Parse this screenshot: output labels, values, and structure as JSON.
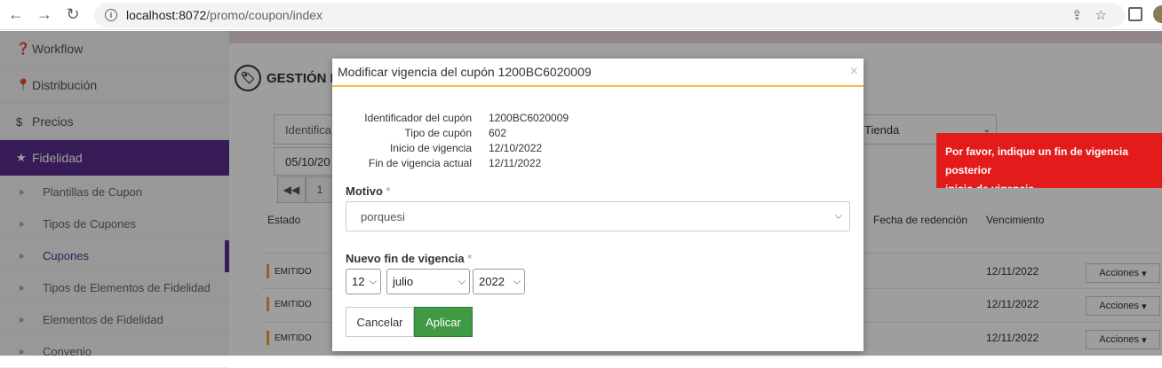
{
  "browser": {
    "url_host": "localhost:8072",
    "url_path": "/promo/coupon/index"
  },
  "sidebar": {
    "items": [
      {
        "label": "Workflow",
        "icon": "question-circle-icon"
      },
      {
        "label": "Distribución",
        "icon": "map-marker-icon"
      },
      {
        "label": "Precios",
        "icon": "dollar-icon"
      },
      {
        "label": "Fidelidad",
        "icon": "star-icon",
        "active": true
      }
    ],
    "subitems": [
      {
        "label": "Plantillas de Cupon"
      },
      {
        "label": "Tipos de Cupones"
      },
      {
        "label": "Cupones",
        "selected": true
      },
      {
        "label": "Tipos de Elementos de Fidelidad"
      },
      {
        "label": "Elementos de Fidelidad"
      },
      {
        "label": "Convenio"
      }
    ]
  },
  "background_page": {
    "title_partial": "GESTIÓN D",
    "filter_identificador_partial": "Identifica",
    "filter_date_partial": "05/10/20",
    "filter_tienda": "Tienda",
    "pager_page": "1",
    "columns": {
      "estado": "Estado",
      "fecha_redencion": "Fecha de redención",
      "vencimiento": "Vencimiento"
    },
    "rows": [
      {
        "estado": "EMITIDO",
        "vencimiento": "12/11/2022",
        "acciones": "Acciones"
      },
      {
        "estado": "EMITIDO",
        "vencimiento": "12/11/2022",
        "acciones": "Acciones"
      },
      {
        "estado": "EMITIDO",
        "vencimiento": "12/11/2022",
        "acciones": "Acciones"
      }
    ]
  },
  "toast": {
    "message_line1": "Por favor, indique un fin de vigencia posterior",
    "message_line2": "inicio de vigencia"
  },
  "modal": {
    "title": "Modificar vigencia del cupón 1200BC6020009",
    "close": "×",
    "info": [
      {
        "label": "Identificador del cupón",
        "value": "1200BC6020009"
      },
      {
        "label": "Tipo de cupón",
        "value": "602"
      },
      {
        "label": "Inicio de vigencia",
        "value": "12/10/2022"
      },
      {
        "label": "Fin de vigencia actual",
        "value": "12/11/2022"
      }
    ],
    "motivo_label": "Motivo",
    "motivo_value": "porquesi",
    "required_mark": "*",
    "nuevo_fin_label": "Nuevo fin de vigencia",
    "day": "12",
    "month": "julio",
    "year": "2022",
    "cancel_label": "Cancelar",
    "apply_label": "Aplicar"
  }
}
